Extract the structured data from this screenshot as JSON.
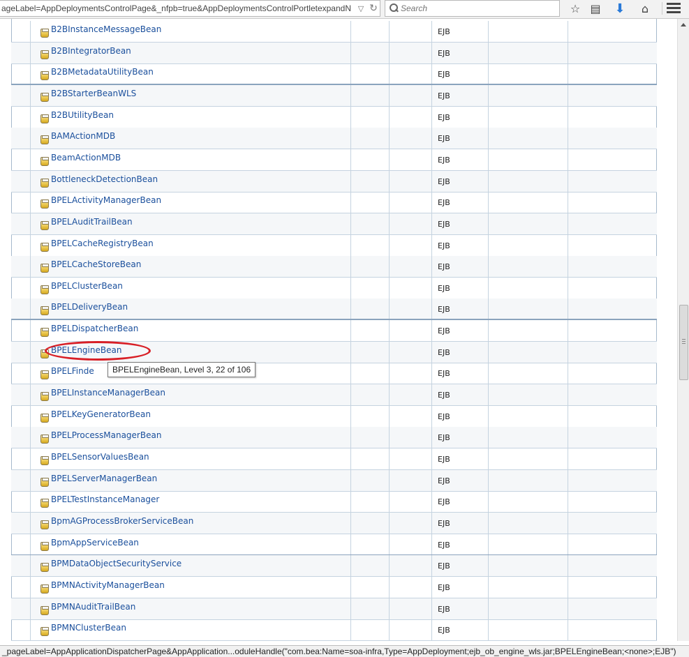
{
  "browser": {
    "url": "ageLabel=AppDeploymentsControlPage&_nfpb=true&AppDeploymentsControlPortletexpandN",
    "search_placeholder": "Search"
  },
  "table": {
    "rows": [
      {
        "name": "B2BInstanceMessageBean",
        "type": "EJB"
      },
      {
        "name": "B2BIntegratorBean",
        "type": "EJB"
      },
      {
        "name": "B2BMetadataUtilityBean",
        "type": "EJB"
      },
      {
        "name": "B2BStarterBeanWLS",
        "type": "EJB"
      },
      {
        "name": "B2BUtilityBean",
        "type": "EJB"
      },
      {
        "name": "BAMActionMDB",
        "type": "EJB"
      },
      {
        "name": "BeamActionMDB",
        "type": "EJB"
      },
      {
        "name": "BottleneckDetectionBean",
        "type": "EJB"
      },
      {
        "name": "BPELActivityManagerBean",
        "type": "EJB"
      },
      {
        "name": "BPELAuditTrailBean",
        "type": "EJB"
      },
      {
        "name": "BPELCacheRegistryBean",
        "type": "EJB"
      },
      {
        "name": "BPELCacheStoreBean",
        "type": "EJB"
      },
      {
        "name": "BPELClusterBean",
        "type": "EJB"
      },
      {
        "name": "BPELDeliveryBean",
        "type": "EJB"
      },
      {
        "name": "BPELDispatcherBean",
        "type": "EJB"
      },
      {
        "name": "BPELEngineBean",
        "type": "EJB"
      },
      {
        "name": "BPELFinde",
        "type": "EJB"
      },
      {
        "name": "BPELInstanceManagerBean",
        "type": "EJB"
      },
      {
        "name": "BPELKeyGeneratorBean",
        "type": "EJB"
      },
      {
        "name": "BPELProcessManagerBean",
        "type": "EJB"
      },
      {
        "name": "BPELSensorValuesBean",
        "type": "EJB"
      },
      {
        "name": "BPELServerManagerBean",
        "type": "EJB"
      },
      {
        "name": "BPELTestInstanceManager",
        "type": "EJB"
      },
      {
        "name": "BpmAGProcessBrokerServiceBean",
        "type": "EJB"
      },
      {
        "name": "BpmAppServiceBean",
        "type": "EJB"
      },
      {
        "name": "BPMDataObjectSecurityService",
        "type": "EJB"
      },
      {
        "name": "BPMNActivityManagerBean",
        "type": "EJB"
      },
      {
        "name": "BPMNAuditTrailBean",
        "type": "EJB"
      },
      {
        "name": "BPMNClusterBean",
        "type": "EJB"
      }
    ]
  },
  "tooltip": {
    "text": "BPELEngineBean, Level 3, 22 of 106"
  },
  "status_bar": {
    "text": "_pageLabel=AppApplicationDispatcherPage&AppApplication...oduleHandle(\"com.bea:Name=soa-infra,Type=AppDeployment;ejb_ob_engine_wls.jar;BPELEngineBean;<none>;EJB\")"
  },
  "colors": {
    "link": "#1a4f9c",
    "highlight": "#d81f26"
  }
}
